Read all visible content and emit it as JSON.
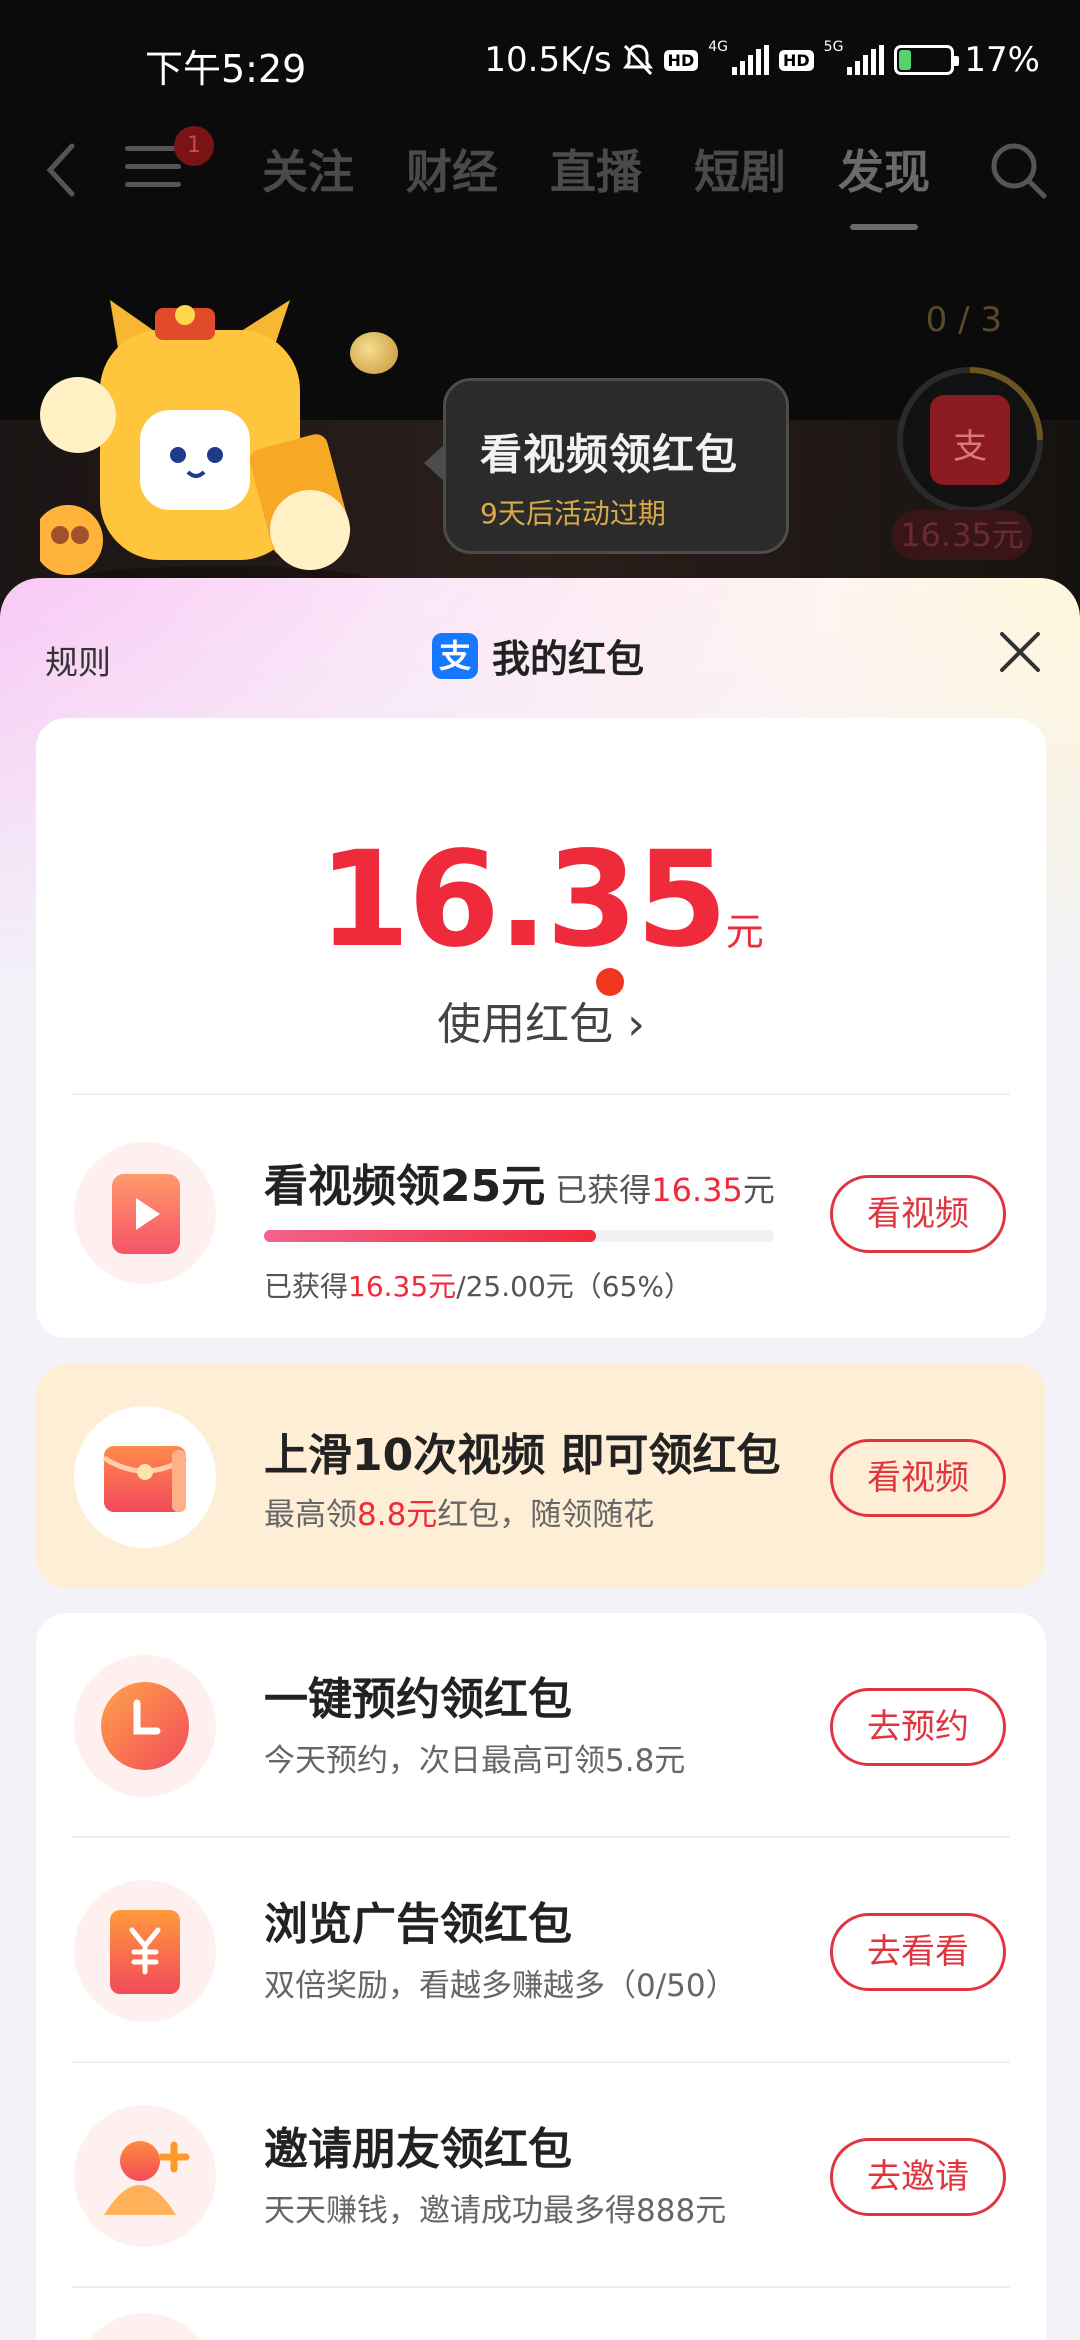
{
  "status_bar": {
    "time": "下午5:29",
    "speed": "10.5K/s",
    "net1": "4G",
    "net2": "5G",
    "hd": "HD",
    "battery": "17%"
  },
  "nav": {
    "badge_count": "1",
    "tabs": [
      "关注",
      "财经",
      "直播",
      "短剧",
      "发现"
    ],
    "active_tab": "发现"
  },
  "banner": {
    "bubble_title": "看视频领红包",
    "bubble_subtitle": "9天后活动过期",
    "counter": "0 / 3",
    "ring_amount": "16.35元",
    "ring_glyph": "支"
  },
  "sheet": {
    "rules_label": "规则",
    "title": "我的红包",
    "alipay_glyph": "支",
    "amount": "16.35",
    "amount_unit": "元",
    "use_label": "使用红包",
    "use_chevron": "›"
  },
  "video_task": {
    "title": "看视频领25元",
    "earned_prefix": "已获得",
    "earned_value": "16.35",
    "earned_unit": "元",
    "progress_prefix": "已获得",
    "progress_value": "16.35元",
    "progress_suffix": "/25.00元（65%）",
    "progress_fraction": 0.65,
    "button": "看视频"
  },
  "promo_task": {
    "title": "上滑10次视频 即可领红包",
    "desc_prefix": "最高领",
    "desc_value": "8.8元",
    "desc_suffix": "红包，随领随花",
    "button": "看视频"
  },
  "tasks": [
    {
      "title": "一键预约领红包",
      "desc": "今天预约，次日最高可领5.8元",
      "button": "去预约",
      "icon": "clock-icon"
    },
    {
      "title": "浏览广告领红包",
      "desc": "双倍奖励，看越多赚越多（0/50）",
      "button": "去看看",
      "icon": "yuan-icon"
    },
    {
      "title": "邀请朋友领红包",
      "desc": "天天赚钱，邀请成功最多得888元",
      "button": "去邀请",
      "icon": "add-user-icon"
    }
  ],
  "colors": {
    "accent_red": "#ef2a3a",
    "alipay_blue": "#1677ff",
    "promo_bg": "#feeed5"
  }
}
